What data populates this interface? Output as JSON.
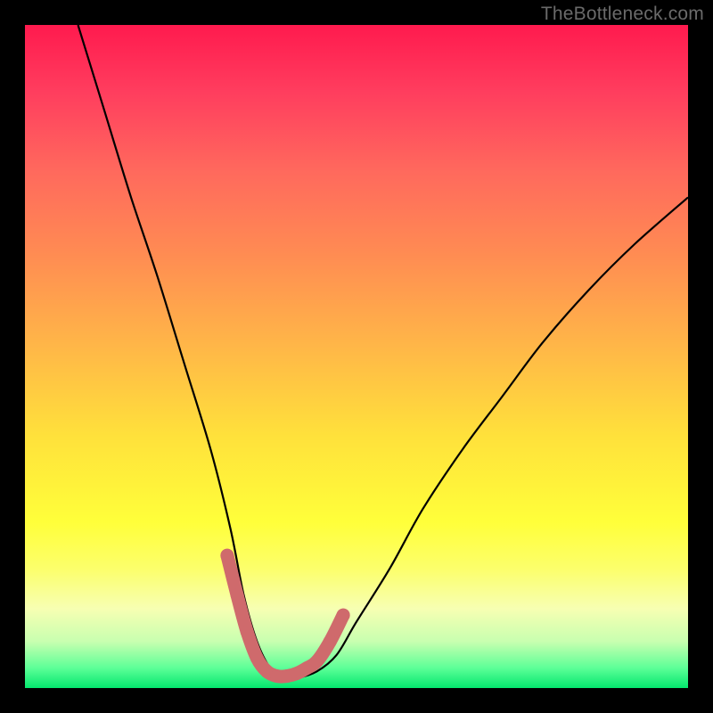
{
  "attribution": "TheBottleneck.com",
  "chart_data": {
    "type": "line",
    "title": "",
    "xlabel": "",
    "ylabel": "",
    "xlim": [
      0,
      100
    ],
    "ylim": [
      0,
      100
    ],
    "series": [
      {
        "name": "curve",
        "x": [
          8,
          12,
          16,
          20,
          24,
          28,
          31,
          33,
          35,
          37,
          39,
          41,
          44,
          47,
          50,
          55,
          60,
          66,
          72,
          78,
          85,
          92,
          100
        ],
        "y": [
          100,
          87,
          74,
          62,
          49,
          36,
          24,
          14,
          7,
          3,
          1.5,
          1.5,
          2.5,
          5,
          10,
          18,
          27,
          36,
          44,
          52,
          60,
          67,
          74
        ]
      }
    ],
    "highlight": {
      "name": "highlight-band",
      "color": "#cf6a6c",
      "x": [
        30.5,
        32.0,
        33.5,
        35.0,
        36.5,
        38.0,
        39.5,
        41.0,
        42.5,
        44.0,
        46.0,
        48.0
      ],
      "y": [
        20.0,
        14.0,
        8.5,
        4.5,
        2.5,
        1.8,
        1.8,
        2.2,
        3.0,
        4.0,
        7.0,
        11.0
      ]
    },
    "gradient_stops": [
      {
        "pos": 0,
        "color": "#ff1a4e"
      },
      {
        "pos": 10,
        "color": "#ff3d5e"
      },
      {
        "pos": 22,
        "color": "#ff695d"
      },
      {
        "pos": 34,
        "color": "#ff8a53"
      },
      {
        "pos": 48,
        "color": "#ffb548"
      },
      {
        "pos": 62,
        "color": "#ffe13b"
      },
      {
        "pos": 75,
        "color": "#ffff3a"
      },
      {
        "pos": 82,
        "color": "#fcff6b"
      },
      {
        "pos": 88,
        "color": "#f7ffb2"
      },
      {
        "pos": 93,
        "color": "#c8ffb0"
      },
      {
        "pos": 97,
        "color": "#5cff97"
      },
      {
        "pos": 100,
        "color": "#04e76e"
      }
    ]
  }
}
